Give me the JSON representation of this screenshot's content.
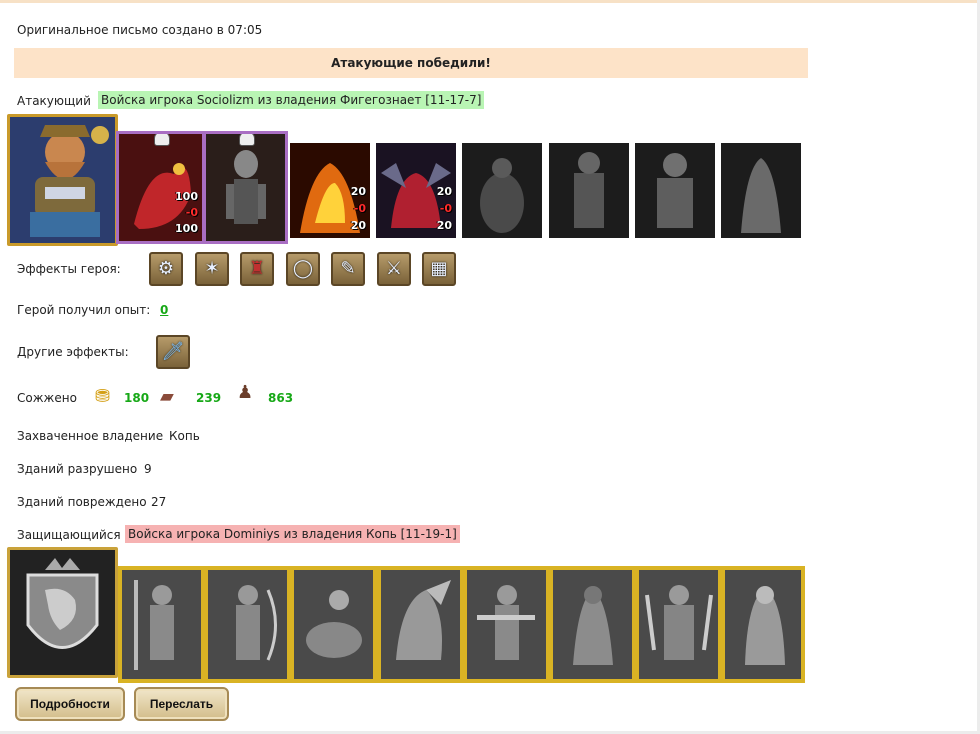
{
  "header": {
    "original_time": "Оригинальное письмо создано в 07:05"
  },
  "result": {
    "banner": "Атакующие победили!"
  },
  "attacker": {
    "label": "Атакующий",
    "name": "Войска игрока Sociolizm из владения Фигегознает [11-17-7]",
    "units": [
      {
        "icon": "red-dragon",
        "top": "100",
        "mid": "-0",
        "bot": "100"
      },
      {
        "icon": "skeleton",
        "top": "",
        "mid": "",
        "bot": ""
      },
      {
        "icon": "fire-beast",
        "top": "20",
        "mid": "-0",
        "bot": "20"
      },
      {
        "icon": "red-demon",
        "top": "20",
        "mid": "-0",
        "bot": "20"
      }
    ]
  },
  "hero_effects": {
    "label": "Эффекты героя:"
  },
  "experience": {
    "label": "Герой получил опыт:",
    "value": "0"
  },
  "other_effects": {
    "label": "Другие эффекты:"
  },
  "burned": {
    "label": "Сожжено",
    "gold": "180",
    "ore": "239",
    "population": "863"
  },
  "captured": {
    "label": "Захваченное владение",
    "value": "Копь"
  },
  "destroyed": {
    "label": "Зданий разрушено",
    "value": "9"
  },
  "damaged": {
    "label": "Зданий повреждено",
    "value": "27"
  },
  "defender": {
    "label": "Защищающийся",
    "name": "Войска игрока Dominiys из владения Копь [11-19-1]"
  },
  "buttons": {
    "details": "Подробности",
    "forward": "Переслать"
  },
  "colors": {
    "banner_bg": "#fde3c8",
    "attacker_bg": "#b9f5b4",
    "defender_bg": "#f6b2b2",
    "number_green": "#17a817"
  }
}
